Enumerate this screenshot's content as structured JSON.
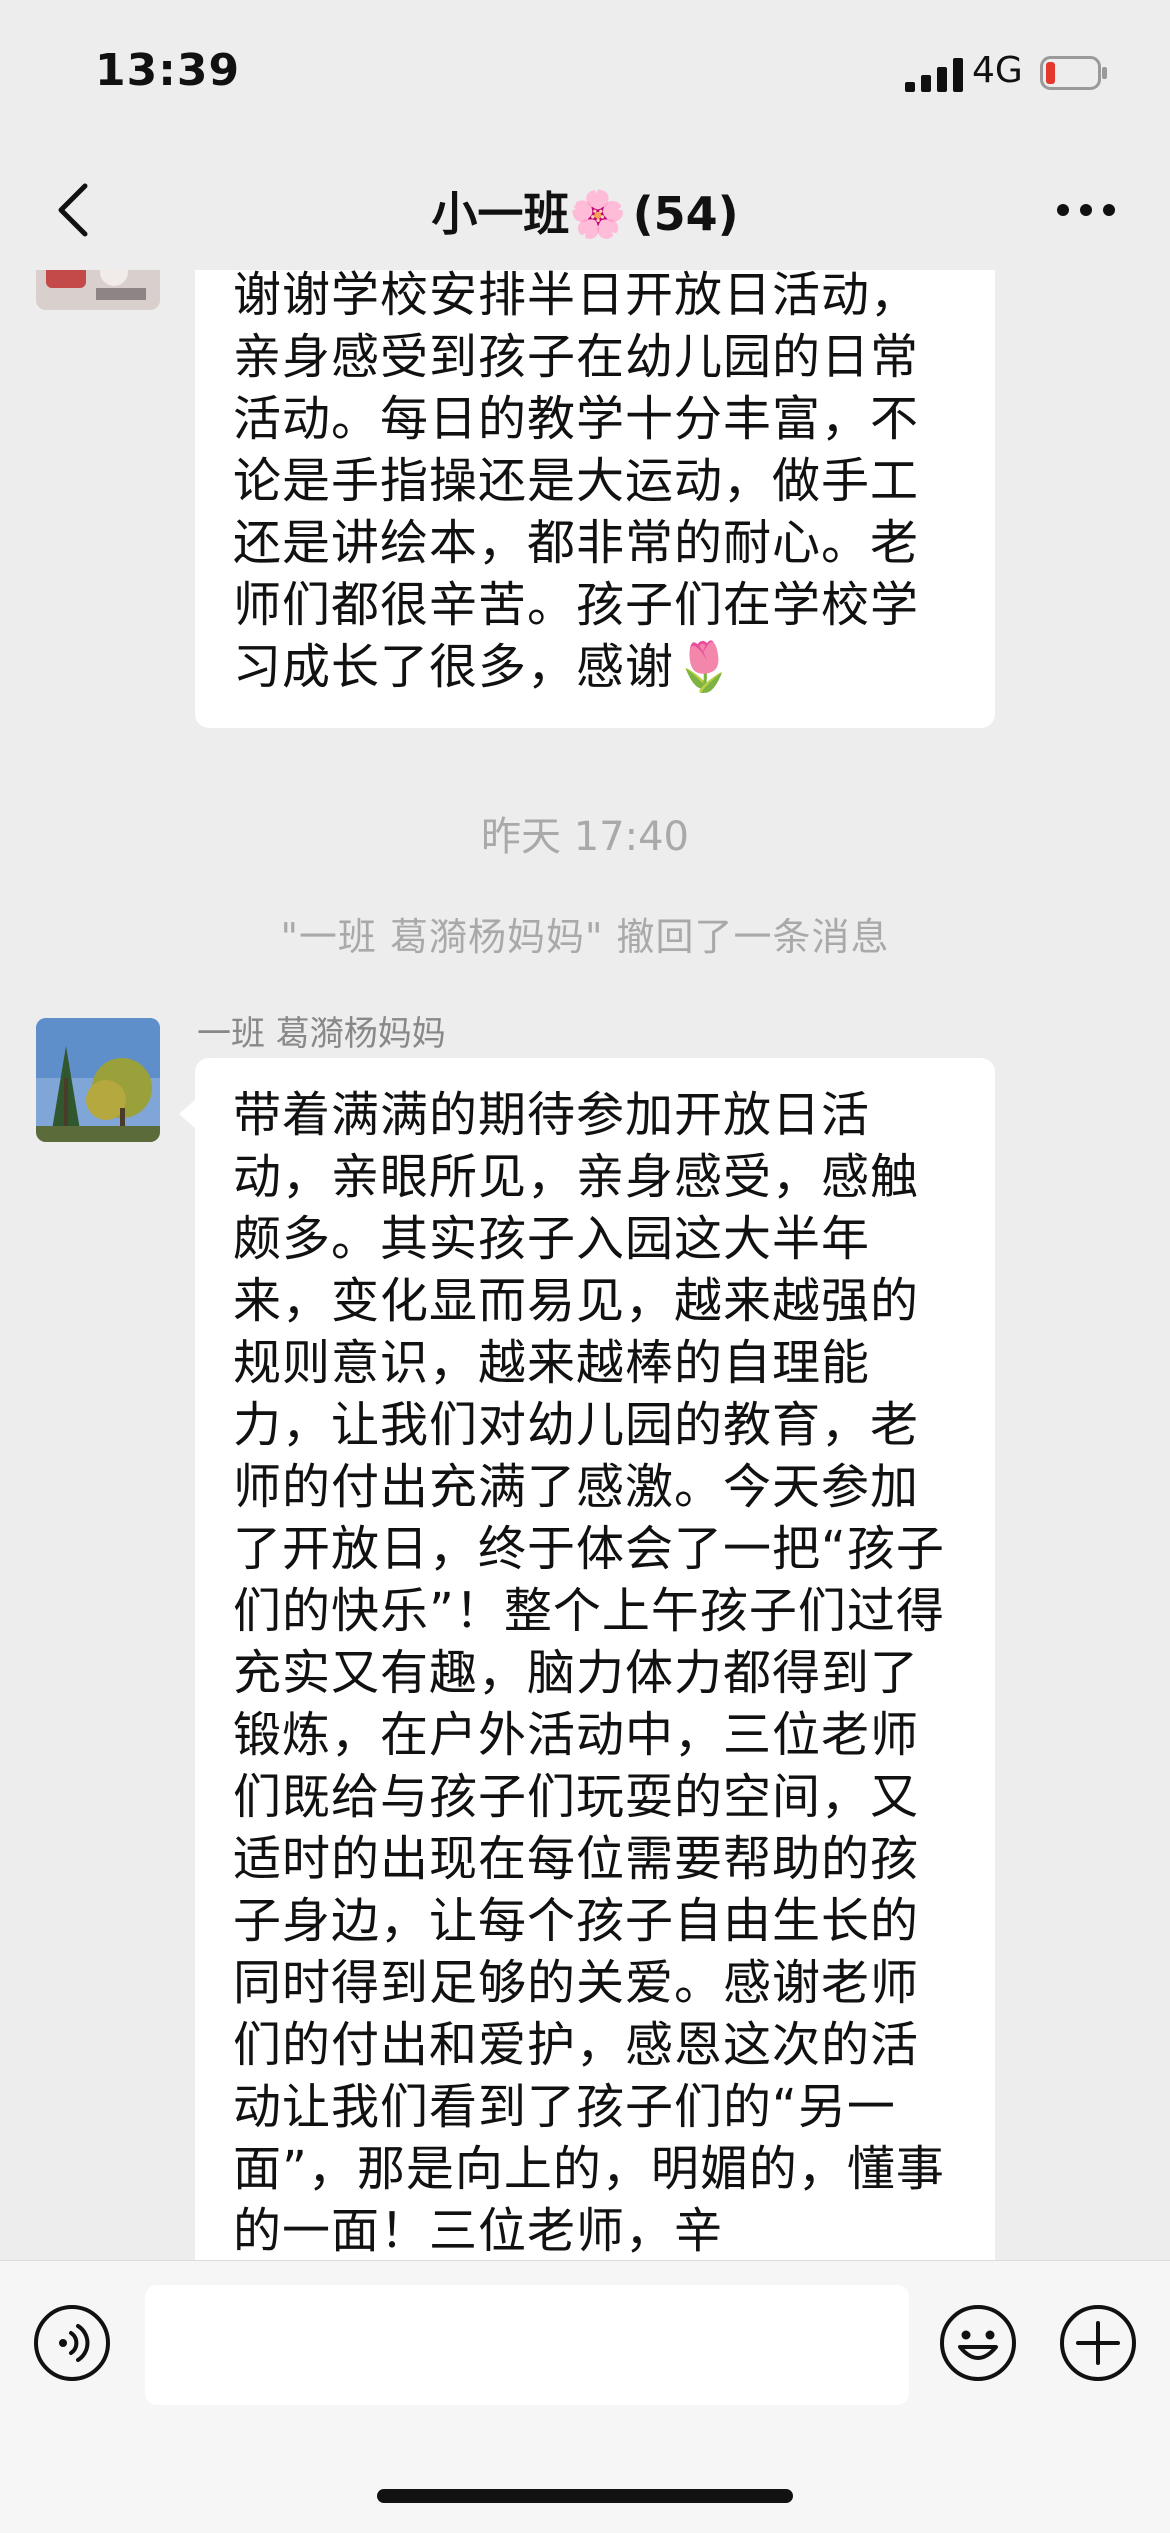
{
  "status_bar": {
    "time": "13:39",
    "network": "4G",
    "battery": "low"
  },
  "header": {
    "title": "小一班🌸",
    "member_count": "(54)"
  },
  "messages": {
    "first_text": "谢谢学校安排半日开放日活动，亲身感受到孩子在幼儿园的日常活动。每日的教学十分丰富，不论是手指操还是大运动，做手工还是讲绘本，都非常的耐心。老师们都很辛苦。孩子们在学校学习成长了很多，感谢🌷",
    "timestamp": "昨天 17:40",
    "recall_notice": "\"一班 葛漪杨妈妈\" 撤回了一条消息",
    "second_sender": "一班 葛漪杨妈妈",
    "second_text": "带着满满的期待参加开放日活动，亲眼所见，亲身感受，感触颇多。其实孩子入园这大半年来，变化显而易见，越来越强的规则意识，越来越棒的自理能力，让我们对幼儿园的教育，老师的付出充满了感激。今天参加了开放日，终于体会了一把“孩子们的快乐”！整个上午孩子们过得充实又有趣，脑力体力都得到了锻炼，在户外活动中，三位老师们既给与孩子们玩耍的空间，又适时的出现在每位需要帮助的孩子身边，让每个孩子自由生长的同时得到足够的关爱。感谢老师们的付出和爱护，感恩这次的活动让我们看到了孩子们的“另一面”，那是向上的，明媚的，懂事的一面！三位老师，辛"
  },
  "input_bar": {
    "placeholder": ""
  },
  "icons": {
    "back": "chevron-left-icon",
    "more": "more-dots-icon",
    "voice": "voice-icon",
    "emoji": "emoji-icon",
    "plus": "plus-icon"
  },
  "colors": {
    "background": "#ededed",
    "bubble": "#ffffff",
    "meta_text": "#a9a9a9",
    "battery_low": "#e5382f"
  }
}
